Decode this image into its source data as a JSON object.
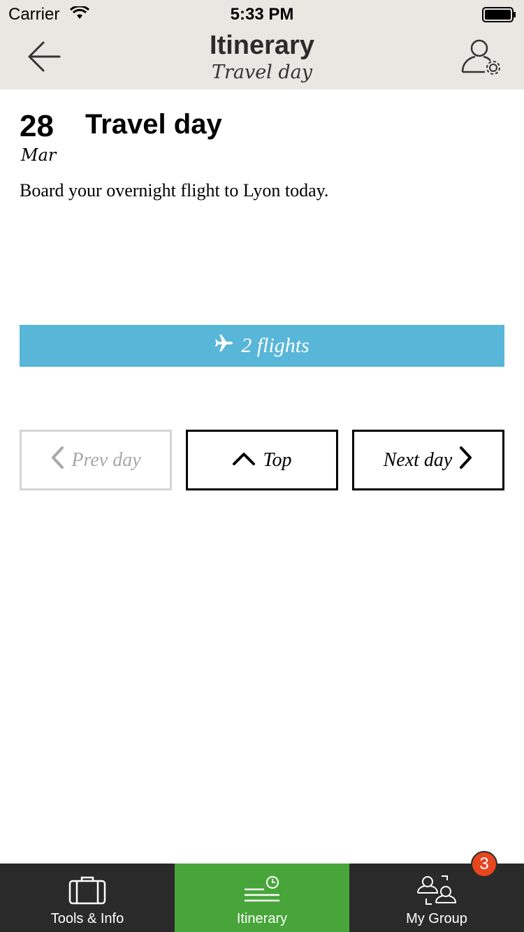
{
  "status_bar": {
    "carrier": "Carrier",
    "time": "5:33 PM"
  },
  "nav": {
    "title": "Itinerary",
    "subtitle": "Travel day",
    "back_icon": "arrow-left-icon",
    "settings_icon": "user-settings-icon"
  },
  "day": {
    "number": "28",
    "month": "Mar",
    "title": "Travel day",
    "description": "Board your overnight flight to Lyon today."
  },
  "flights": {
    "label": "2 flights",
    "icon": "airplane-icon",
    "color": "#58b6d9"
  },
  "day_nav": {
    "prev_label": "Prev day",
    "top_label": "Top",
    "next_label": "Next day"
  },
  "tab_bar": {
    "tabs": [
      {
        "label": "Tools & Info",
        "icon": "suitcase-icon",
        "active": false
      },
      {
        "label": "Itinerary",
        "icon": "itinerary-clock-icon",
        "active": true
      },
      {
        "label": "My Group",
        "icon": "group-icon",
        "active": false
      }
    ],
    "badge_count": "3",
    "active_color": "#47a53a",
    "badge_color": "#e8461f"
  }
}
